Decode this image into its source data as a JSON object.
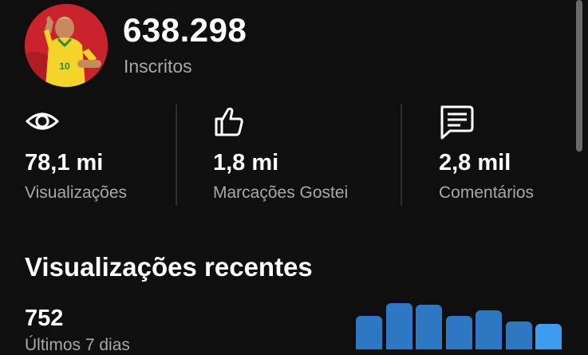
{
  "channel": {
    "subscriber_count": "638.298",
    "subscriber_label": "Inscritos"
  },
  "stats": [
    {
      "icon": "eye-icon",
      "value": "78,1 mi",
      "label": "Visualizações"
    },
    {
      "icon": "thumbs-up-icon",
      "value": "1,8 mi",
      "label": "Marcações Gostei"
    },
    {
      "icon": "comment-icon",
      "value": "2,8 mil",
      "label": "Comentários"
    }
  ],
  "recent_views": {
    "title": "Visualizações recentes",
    "value": "752",
    "period_label": "Últimos 7 dias"
  },
  "chart_data": {
    "type": "bar",
    "values": [
      0.72,
      1.0,
      0.97,
      0.73,
      0.84,
      0.6,
      0.55
    ],
    "colors": [
      "#2e78c2",
      "#2e78c2",
      "#2e78c2",
      "#2e78c2",
      "#2e78c2",
      "#2e78c2",
      "#3d9cf0"
    ]
  },
  "colors": {
    "background": "#0f0f0f",
    "secondary_text": "#a8a8a8",
    "bar": "#2e78c2",
    "bar_highlight": "#3d9cf0"
  }
}
